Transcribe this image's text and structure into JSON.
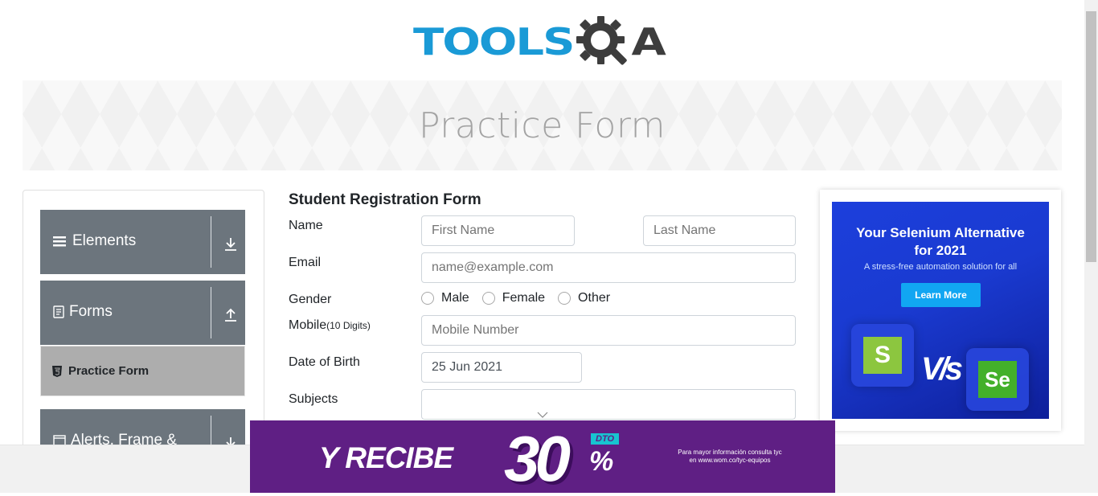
{
  "logo": {
    "part1": "TOOLS",
    "part2": "A",
    "brand_blue": "#1a9ad6",
    "brand_dark": "#3d3d3d"
  },
  "banner": {
    "title": "Practice Form"
  },
  "sidebar": {
    "groups": [
      {
        "label": "Elements",
        "icon": "list-icon",
        "arrow": "download-arrow-icon"
      },
      {
        "label": "Forms",
        "icon": "document-icon",
        "arrow": "upload-arrow-icon"
      },
      {
        "label": "Alerts, Frame &",
        "icon": "window-icon",
        "arrow": "download-arrow-icon"
      }
    ],
    "active_item": {
      "label": "Practice Form",
      "icon": "html5-icon"
    },
    "group_color": "#6c757d",
    "active_color": "#adadad"
  },
  "form": {
    "title": "Student Registration Form",
    "name_label": "Name",
    "first_name_placeholder": "First Name",
    "last_name_placeholder": "Last Name",
    "email_label": "Email",
    "email_placeholder": "name@example.com",
    "gender_label": "Gender",
    "gender_options": [
      "Male",
      "Female",
      "Other"
    ],
    "mobile_label": "Mobile",
    "mobile_hint": "(10 Digits)",
    "mobile_placeholder": "Mobile Number",
    "dob_label": "Date of Birth",
    "dob_value": "25 Jun 2021",
    "subjects_label": "Subjects"
  },
  "right_ad": {
    "headline_line1": "Your Selenium Alternative",
    "headline_line2": "for 2021",
    "subtext": "A stress-free automation solution for all",
    "button": "Learn More",
    "vs": "V/s",
    "left_logo": "S",
    "right_logo": "Se",
    "bg_color": "#1c3fdc",
    "button_color": "#11a6f2"
  },
  "bottom_ad": {
    "headline": "Y RECIBE",
    "percent_number": "30",
    "percent_sign": "%",
    "badge": "DTO",
    "info_line1": "Para mayor información consulta tyc",
    "info_line2": "en www.wom.co/tyc-equipos",
    "bg_color": "#5f1f84"
  }
}
